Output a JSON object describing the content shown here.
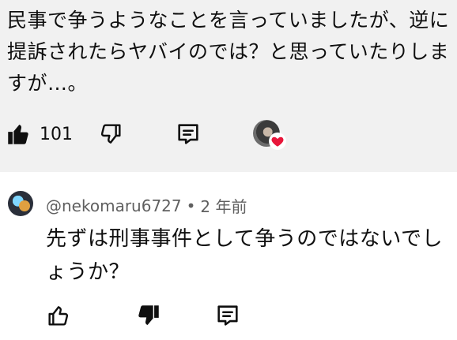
{
  "parent_comment": {
    "text": "民事で争うようなことを言っていましたが、逆に提訴されたらヤバイのでは？と思っていたりしますが…。",
    "like_count": "101"
  },
  "reply": {
    "author": "@nekomaru6727",
    "separator": "•",
    "time_ago": "2 年前",
    "text": "先ずは刑事事件として争うのではないでしょうか？"
  },
  "colors": {
    "top_background": "#f1f1f1",
    "heart": "#e8163a",
    "meta_text": "#606060"
  }
}
